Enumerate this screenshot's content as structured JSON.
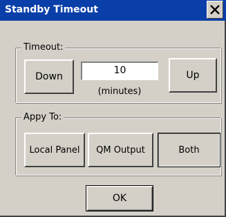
{
  "window": {
    "title": "Standby Timeout",
    "close_symbol": "close-icon"
  },
  "timeout_group": {
    "label": "Timeout:",
    "down_label": "Down",
    "value": "10",
    "units": "(minutes)",
    "up_label": "Up"
  },
  "apply_group": {
    "label": "Appy To:",
    "options": [
      "Local Panel",
      "QM Output",
      "Both"
    ],
    "selected": "Both"
  },
  "footer": {
    "ok_label": "OK"
  },
  "colors": {
    "titlebar": "#0a3ea8",
    "face": "#d4d0c8"
  }
}
